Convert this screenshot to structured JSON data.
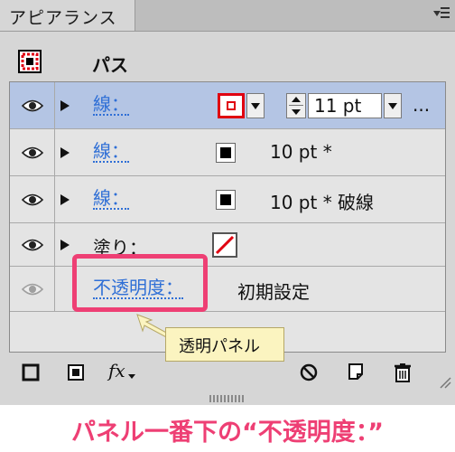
{
  "panel": {
    "tab_title": "アピアランス"
  },
  "header": {
    "object_label": "パス"
  },
  "rows": [
    {
      "label": "線：",
      "stroke_value": "11 pt",
      "more": "..."
    },
    {
      "label": "線：",
      "value": "10 pt *"
    },
    {
      "label": "線：",
      "value": "10 pt * 破線"
    },
    {
      "label": "塗り："
    },
    {
      "label": "不透明度：",
      "value": "初期設定"
    }
  ],
  "callout": {
    "text": "透明パネル"
  },
  "toolbar": {
    "icons": [
      "add-stroke-icon",
      "add-fill-icon",
      "fx-icon",
      "clear-icon",
      "duplicate-icon",
      "trash-icon"
    ],
    "fx_label": "fx"
  },
  "caption": "パネル一番下の“不透明度：”",
  "colors": {
    "accent": "#ee3f74",
    "link": "#2f6fd6",
    "selected_row": "#b4c5e4",
    "stroke_red": "#e00010",
    "callout_bg": "#fbf4c0"
  }
}
